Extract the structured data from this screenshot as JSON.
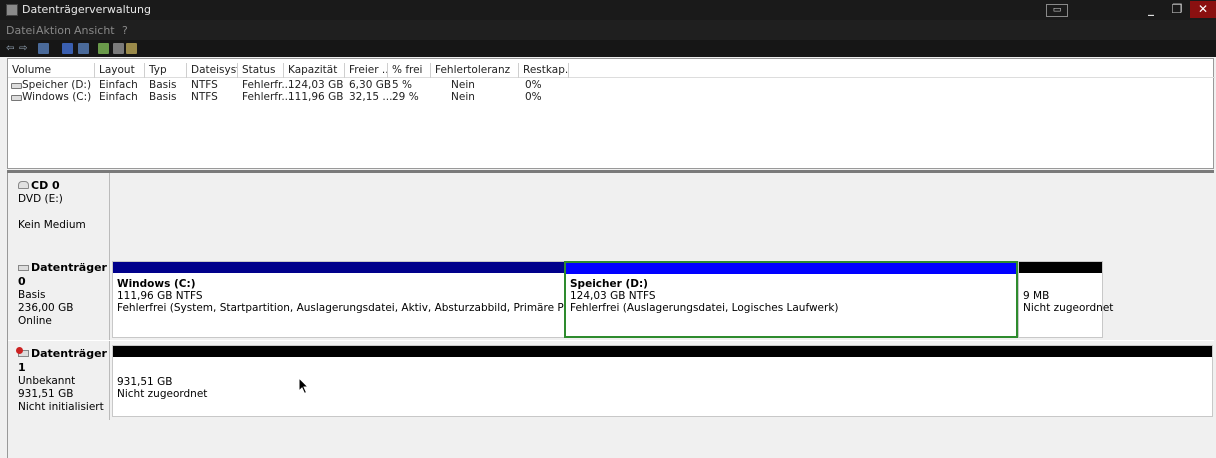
{
  "window": {
    "title": "Datenträgerverwaltung"
  },
  "menu": [
    "Datei",
    "Aktion",
    "Ansicht",
    "?"
  ],
  "table": {
    "columns": [
      "Volume",
      "Layout",
      "Typ",
      "Dateisyst...",
      "Status",
      "Kapazität",
      "Freier ...",
      "% frei",
      "Fehlertoleranz",
      "Restkap..."
    ],
    "rows": [
      [
        "Speicher (D:)",
        "Einfach",
        "Basis",
        "NTFS",
        "Fehlerfr...",
        "124,03 GB",
        "6,30 GB",
        "5 %",
        "Nein",
        "0%"
      ],
      [
        "Windows (C:)",
        "Einfach",
        "Basis",
        "NTFS",
        "Fehlerfr...",
        "111,96 GB",
        "32,15 ...",
        "29 %",
        "Nein",
        "0%"
      ]
    ]
  },
  "disks": {
    "cd0": {
      "name": "CD 0",
      "line1": "DVD (E:)",
      "line2": "",
      "line3": "Kein Medium"
    },
    "disk0": {
      "name": "Datenträger 0",
      "type": "Basis",
      "size": "236,00 GB",
      "status": "Online",
      "partitions": [
        {
          "name": "Windows  (C:)",
          "size": "111,96 GB NTFS",
          "status": "Fehlerfrei (System, Startpartition, Auslagerungsdatei, Aktiv, Absturzabbild, Primäre Partition)",
          "color": "#00008b"
        },
        {
          "name": "Speicher  (D:)",
          "size": "124,03 GB NTFS",
          "status": "Fehlerfrei (Auslagerungsdatei, Logisches Laufwerk)",
          "color": "#0000ff"
        },
        {
          "name": "",
          "size": "9 MB",
          "status": "Nicht zugeordnet",
          "color": "#000000"
        }
      ]
    },
    "disk1": {
      "name": "Datenträger 1",
      "type": "Unbekannt",
      "size": "931,51 GB",
      "status": "Nicht initialisiert",
      "partitions": [
        {
          "size": "931,51 GB",
          "status": "Nicht zugeordnet",
          "color": "#000000"
        }
      ]
    }
  },
  "colors": {
    "primary": "#00008b",
    "logical": "#0000ff",
    "unallocated": "#000000",
    "selected_border": "#2e8b2e"
  }
}
